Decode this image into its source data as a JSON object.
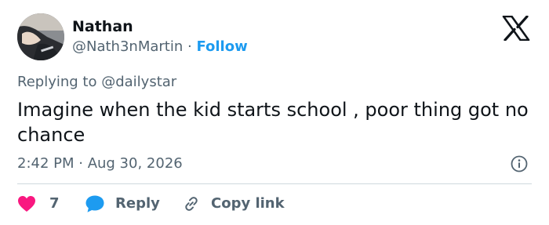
{
  "tweet": {
    "author": {
      "display_name": "Nathan",
      "handle": "@Nath3nMartin",
      "separator": "·",
      "follow_label": "Follow",
      "avatar_icon": "profile-photo"
    },
    "brand_icon": "x-logo-icon",
    "replying_to_prefix": "Replying to ",
    "replying_to_handle": "@dailystar",
    "text": "Imagine when the kid starts school , poor thing got no chance",
    "timestamp": "2:42 PM · Aug 30, 2026",
    "info_icon": "info-icon",
    "actions": {
      "like_count": "7",
      "reply_label": "Reply",
      "copy_link_label": "Copy link"
    }
  },
  "colors": {
    "text_primary": "#0f1419",
    "text_secondary": "#536471",
    "link": "#1d9bf0",
    "like": "#f91880",
    "reply": "#1d9bf0",
    "divider": "#cfd9de"
  }
}
